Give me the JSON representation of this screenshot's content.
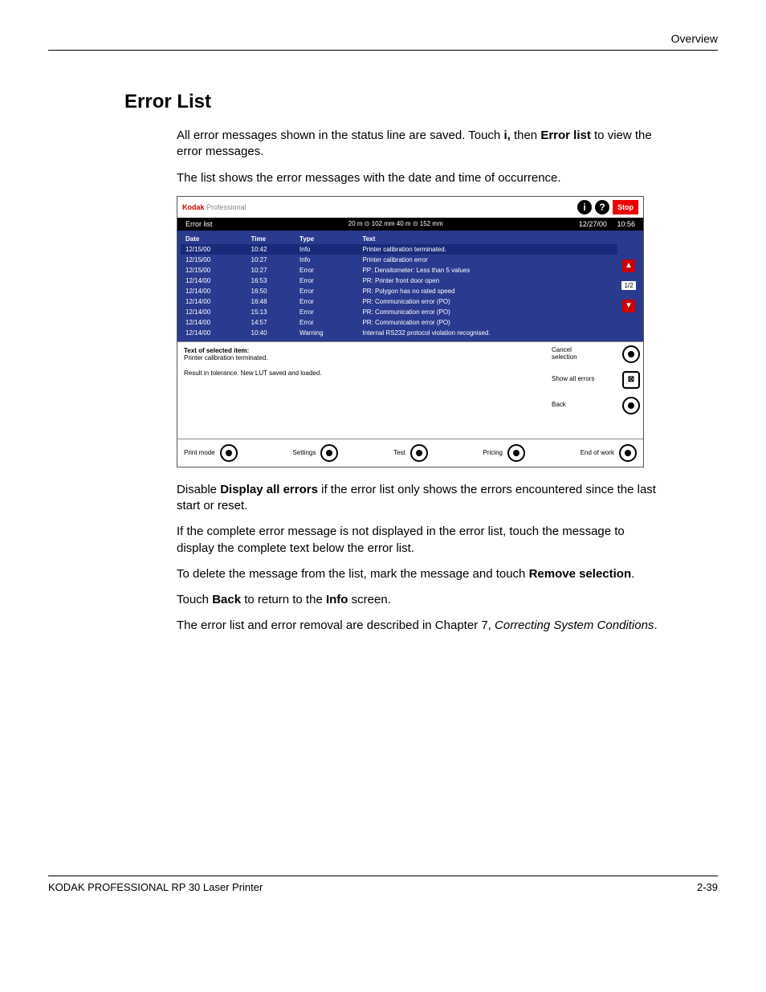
{
  "header": {
    "section": "Overview"
  },
  "title": "Error List",
  "intro": {
    "p1a": "All error messages shown in the status line are saved. Touch ",
    "p1b": "i,",
    "p1c": " then ",
    "p1d": "Error list",
    "p1e": " to view the error messages.",
    "p2": "The list shows the error messages with the date and time of occurrence."
  },
  "screenshot": {
    "brand1": "Kodak",
    "brand2": " Professional",
    "stop": "Stop",
    "info_glyph": "i",
    "help_glyph": "?",
    "bar_title": "Error list",
    "bar_mid": "20 m ⊙ 102 mm   40 m ⊙ 152 mm",
    "bar_date": "12/27/00",
    "bar_time": "10:56",
    "cols": {
      "date": "Date",
      "time": "Time",
      "type": "Type",
      "text": "Text"
    },
    "rows": [
      {
        "date": "12/15/00",
        "time": "10:42",
        "type": "Info",
        "text": "Printer calibration terminated.",
        "sel": true
      },
      {
        "date": "12/15/00",
        "time": "10:27",
        "type": "Info",
        "text": "Printer calibration error"
      },
      {
        "date": "12/15/00",
        "time": "10:27",
        "type": "Error",
        "text": "PP: Densitometer: Less than 5 values"
      },
      {
        "date": "12/14/00",
        "time": "16:53",
        "type": "Error",
        "text": "PR: Printer front door open"
      },
      {
        "date": "12/14/00",
        "time": "16:50",
        "type": "Error",
        "text": "PR: Polygon has no rated speed"
      },
      {
        "date": "12/14/00",
        "time": "16:48",
        "type": "Error",
        "text": "PR: Communication error (PO)"
      },
      {
        "date": "12/14/00",
        "time": "15:13",
        "type": "Error",
        "text": "PR: Communication error (PO)"
      },
      {
        "date": "12/14/00",
        "time": "14:57",
        "type": "Error",
        "text": "PR: Communication error (PO)"
      },
      {
        "date": "12/14/00",
        "time": "10:40",
        "type": "Warning",
        "text": "Internal RS232 protocol violation recognised."
      }
    ],
    "page_ind": "1/2",
    "up_glyph": "▲",
    "down_glyph": "▼",
    "detail_header": "Text of selected item:",
    "detail_line1": "Printer calibration terminated.",
    "detail_line2": "Result in tolerance. New LUT saved and loaded.",
    "side_buttons": {
      "cancel": "Cancel selection",
      "showall": "Show all errors",
      "back": "Back",
      "x_glyph": "⊠"
    },
    "bottom": {
      "print_mode": "Print mode",
      "settings": "Settings",
      "test": "Test",
      "pricing": "Pricing",
      "end_of_work": "End of work"
    }
  },
  "after": {
    "p1a": "Disable ",
    "p1b": "Display all errors",
    "p1c": " if the error list only shows the errors encountered since the last start or reset.",
    "p2": "If the complete error message is not displayed in the error list, touch the message to display the complete text below the error list.",
    "p3a": "To delete the message from the list, mark the message and touch ",
    "p3b": "Remove selection",
    "p3c": ".",
    "p4a": "Touch ",
    "p4b": "Back",
    "p4c": " to return to the ",
    "p4d": "Info",
    "p4e": " screen."
  },
  "closing": {
    "a": "The error list and error removal are described in Chapter 7, ",
    "b": "Correcting System Conditions",
    "c": "."
  },
  "footer": {
    "left": "KODAK PROFESSIONAL RP 30 Laser Printer",
    "right": "2-39"
  }
}
